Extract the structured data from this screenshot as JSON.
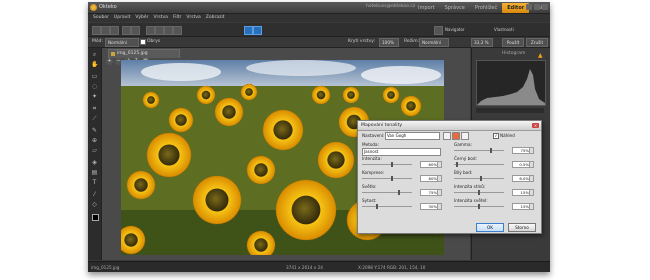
{
  "app": {
    "title": "Okteko"
  },
  "title_bar": {
    "account": "hotebuss@oktekoo.cz",
    "tabs": [
      {
        "label": "Import",
        "active": false
      },
      {
        "label": "Správce",
        "active": false
      },
      {
        "label": "Prohlížeč",
        "active": false
      },
      {
        "label": "Editor",
        "active": true
      },
      {
        "label": "RAW",
        "active": false
      }
    ]
  },
  "menu": [
    "Soubor",
    "Upravit",
    "Výběr",
    "Vrstva",
    "Filtr",
    "Vrstva",
    "Zobrazit"
  ],
  "toolbar": {
    "toggle_navigator": "Navigator",
    "toggle_properties": "Vlastnosti"
  },
  "options": {
    "mode_label": "Mód:",
    "mode_value": "Normální",
    "cover_label": "Obrys",
    "opacity_label": "Krytí vrstvy:",
    "opacity_value": "100%",
    "blend_label": "Režim:",
    "blend_value": "Normální",
    "zoom_value": "33,3 %",
    "apply_label": "Použít",
    "cancel_label": "Zrušit"
  },
  "document": {
    "tab_label": "img_0125.jpg"
  },
  "right_panel": {
    "title": "Histogram"
  },
  "status": {
    "filename": "img_0125.jpg",
    "dimensions": "3741 x 2614 x 24",
    "coords": "X:2098  Y:174  RGB: 201, 154, 10"
  },
  "dialog": {
    "title": "Mapování tonality",
    "preset_label": "Nastavení:",
    "preset_value": "Van Gogh",
    "preview_label": "Náhled",
    "method_label": "Metoda:",
    "method_value": "Jasnost",
    "left_params": [
      {
        "label": "Intenzita:",
        "value": "60%",
        "pos": 0.6
      },
      {
        "label": "Komprese:",
        "value": "60%",
        "pos": 0.6
      },
      {
        "label": "Světlo:",
        "value": "75%",
        "pos": 0.75
      },
      {
        "label": "Sytost:",
        "value": "30%",
        "pos": 0.3
      }
    ],
    "right_params": [
      {
        "label": "Gamma:",
        "value": "75%",
        "pos": 0.75
      },
      {
        "label": "Černý bod:",
        "value": "0.5%",
        "pos": 0.05
      },
      {
        "label": "Bílý bod:",
        "value": "6.0%",
        "pos": 0.55
      },
      {
        "label": "Intenzita stínů:",
        "value": "15%",
        "pos": 0.5
      },
      {
        "label": "Intenzita světel:",
        "value": "15%",
        "pos": 0.5
      }
    ],
    "ok_label": "OK",
    "cancel_label": "Storno"
  }
}
